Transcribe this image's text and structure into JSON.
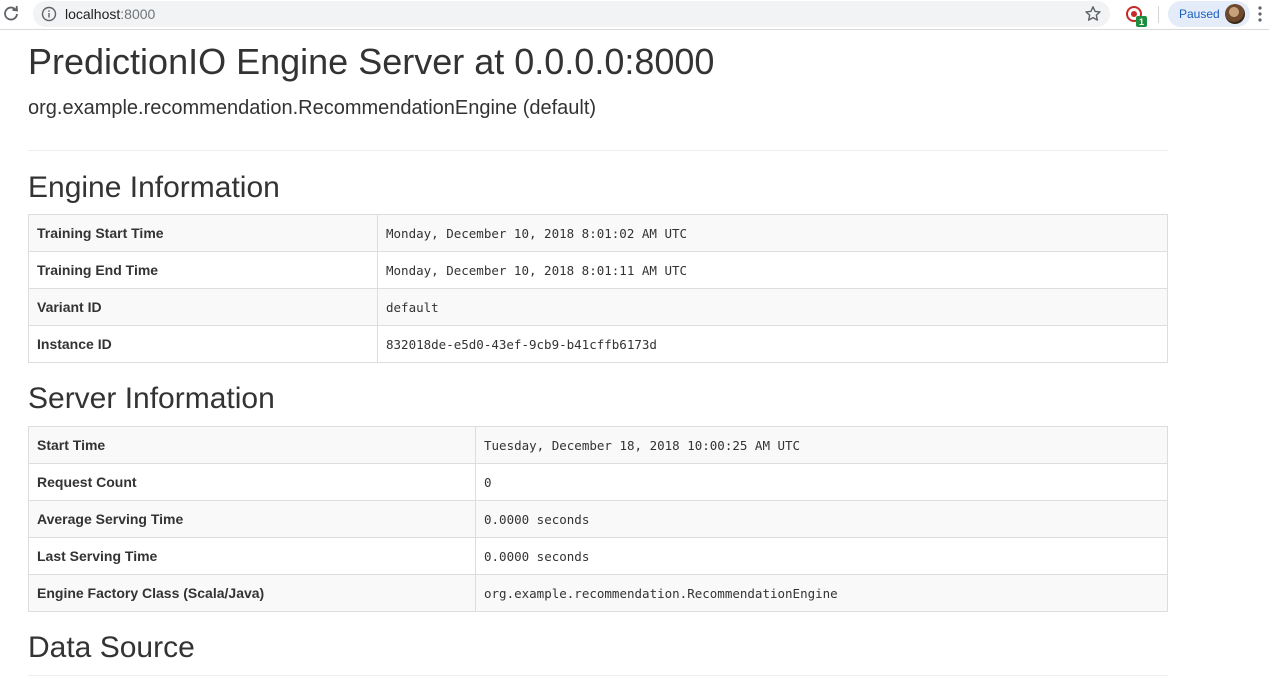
{
  "browser": {
    "url_host": "localhost",
    "url_port": ":8000",
    "profile_status": "Paused",
    "extension_badge": "1"
  },
  "page": {
    "title": "PredictionIO Engine Server at 0.0.0.0:8000",
    "subtitle": "org.example.recommendation.RecommendationEngine (default)"
  },
  "engine_info": {
    "heading": "Engine Information",
    "rows": [
      {
        "key": "Training Start Time",
        "value": "Monday, December 10, 2018 8:01:02 AM UTC"
      },
      {
        "key": "Training End Time",
        "value": "Monday, December 10, 2018 8:01:11 AM UTC"
      },
      {
        "key": "Variant ID",
        "value": "default"
      },
      {
        "key": "Instance ID",
        "value": "832018de-e5d0-43ef-9cb9-b41cffb6173d"
      }
    ]
  },
  "server_info": {
    "heading": "Server Information",
    "rows": [
      {
        "key": "Start Time",
        "value": "Tuesday, December 18, 2018 10:00:25 AM UTC"
      },
      {
        "key": "Request Count",
        "value": "0"
      },
      {
        "key": "Average Serving Time",
        "value": "0.0000 seconds"
      },
      {
        "key": "Last Serving Time",
        "value": "0.0000 seconds"
      },
      {
        "key": "Engine Factory Class (Scala/Java)",
        "value": "org.example.recommendation.RecommendationEngine"
      }
    ]
  },
  "data_source": {
    "heading": "Data Source"
  }
}
